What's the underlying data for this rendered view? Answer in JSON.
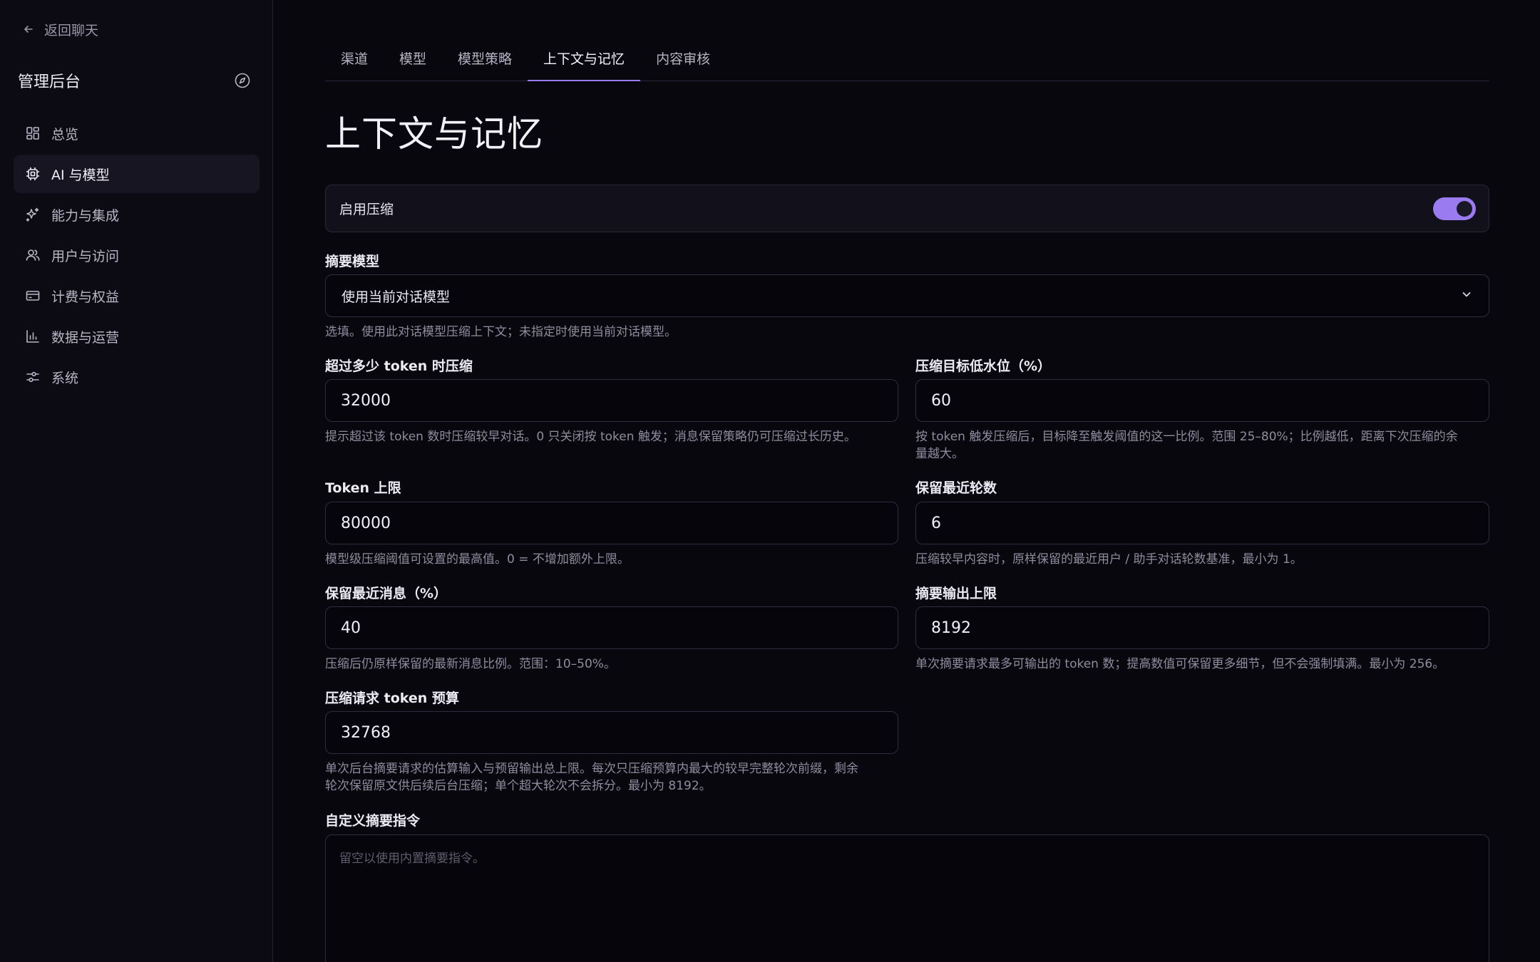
{
  "sidebar": {
    "back_label": "返回聊天",
    "title": "管理后台",
    "items": [
      {
        "label": "总览",
        "icon": "dashboard-icon"
      },
      {
        "label": "AI 与模型",
        "icon": "chip-icon",
        "active": true
      },
      {
        "label": "能力与集成",
        "icon": "sparkle-icon"
      },
      {
        "label": "用户与访问",
        "icon": "users-icon"
      },
      {
        "label": "计费与权益",
        "icon": "credit-card-icon"
      },
      {
        "label": "数据与运营",
        "icon": "bar-chart-icon"
      },
      {
        "label": "系统",
        "icon": "sliders-icon"
      }
    ]
  },
  "tabs": [
    {
      "label": "渠道"
    },
    {
      "label": "模型"
    },
    {
      "label": "模型策略"
    },
    {
      "label": "上下文与记忆",
      "active": true
    },
    {
      "label": "内容审核"
    }
  ],
  "page": {
    "title": "上下文与记忆"
  },
  "compression_toggle": {
    "label": "启用压缩",
    "enabled": true
  },
  "summary_model": {
    "label": "摘要模型",
    "value": "使用当前对话模型",
    "help": "选填。使用此对话模型压缩上下文；未指定时使用当前对话模型。"
  },
  "fields": {
    "threshold": {
      "label": "超过多少 token 时压缩",
      "value": "32000",
      "help": "提示超过该 token 数时压缩较早对话。0 只关闭按 token 触发；消息保留策略仍可压缩过长历史。"
    },
    "low_water": {
      "label": "压缩目标低水位（%）",
      "value": "60",
      "help_1": "按 token 触发压缩后，目标降至触发阈值的这一比例。范围 25–80%；比例越低，距离下次压缩的余",
      "help_2": "量越大。"
    },
    "token_limit": {
      "label": "Token 上限",
      "value": "80000",
      "help": "模型级压缩阈值可设置的最高值。0 = 不增加额外上限。"
    },
    "keep_turns": {
      "label": "保留最近轮数",
      "value": "6",
      "help": "压缩较早内容时，原样保留的最近用户 / 助手对话轮数基准，最小为 1。"
    },
    "keep_recent": {
      "label": "保留最近消息（%）",
      "value": "40",
      "help": "压缩后仍原样保留的最新消息比例。范围：10–50%。"
    },
    "summary_output": {
      "label": "摘要输出上限",
      "value": "8192",
      "help": "单次摘要请求最多可输出的 token 数；提高数值可保留更多细节，但不会强制填满。最小为 256。"
    },
    "request_budget": {
      "label": "压缩请求 token 预算",
      "value": "32768",
      "help_1": "单次后台摘要请求的估算输入与预留输出总上限。每次只压缩预算内最大的较早完整轮次前缀，剩余",
      "help_2": "轮次保留原文供后续后台压缩；单个超大轮次不会拆分。最小为 8192。"
    },
    "custom_prompt": {
      "label": "自定义摘要指令",
      "placeholder": "留空以使用内置摘要指令。"
    }
  },
  "colors": {
    "accent": "#9b7cf0",
    "background": "#08070e",
    "sidebar": "#0c0b14"
  }
}
